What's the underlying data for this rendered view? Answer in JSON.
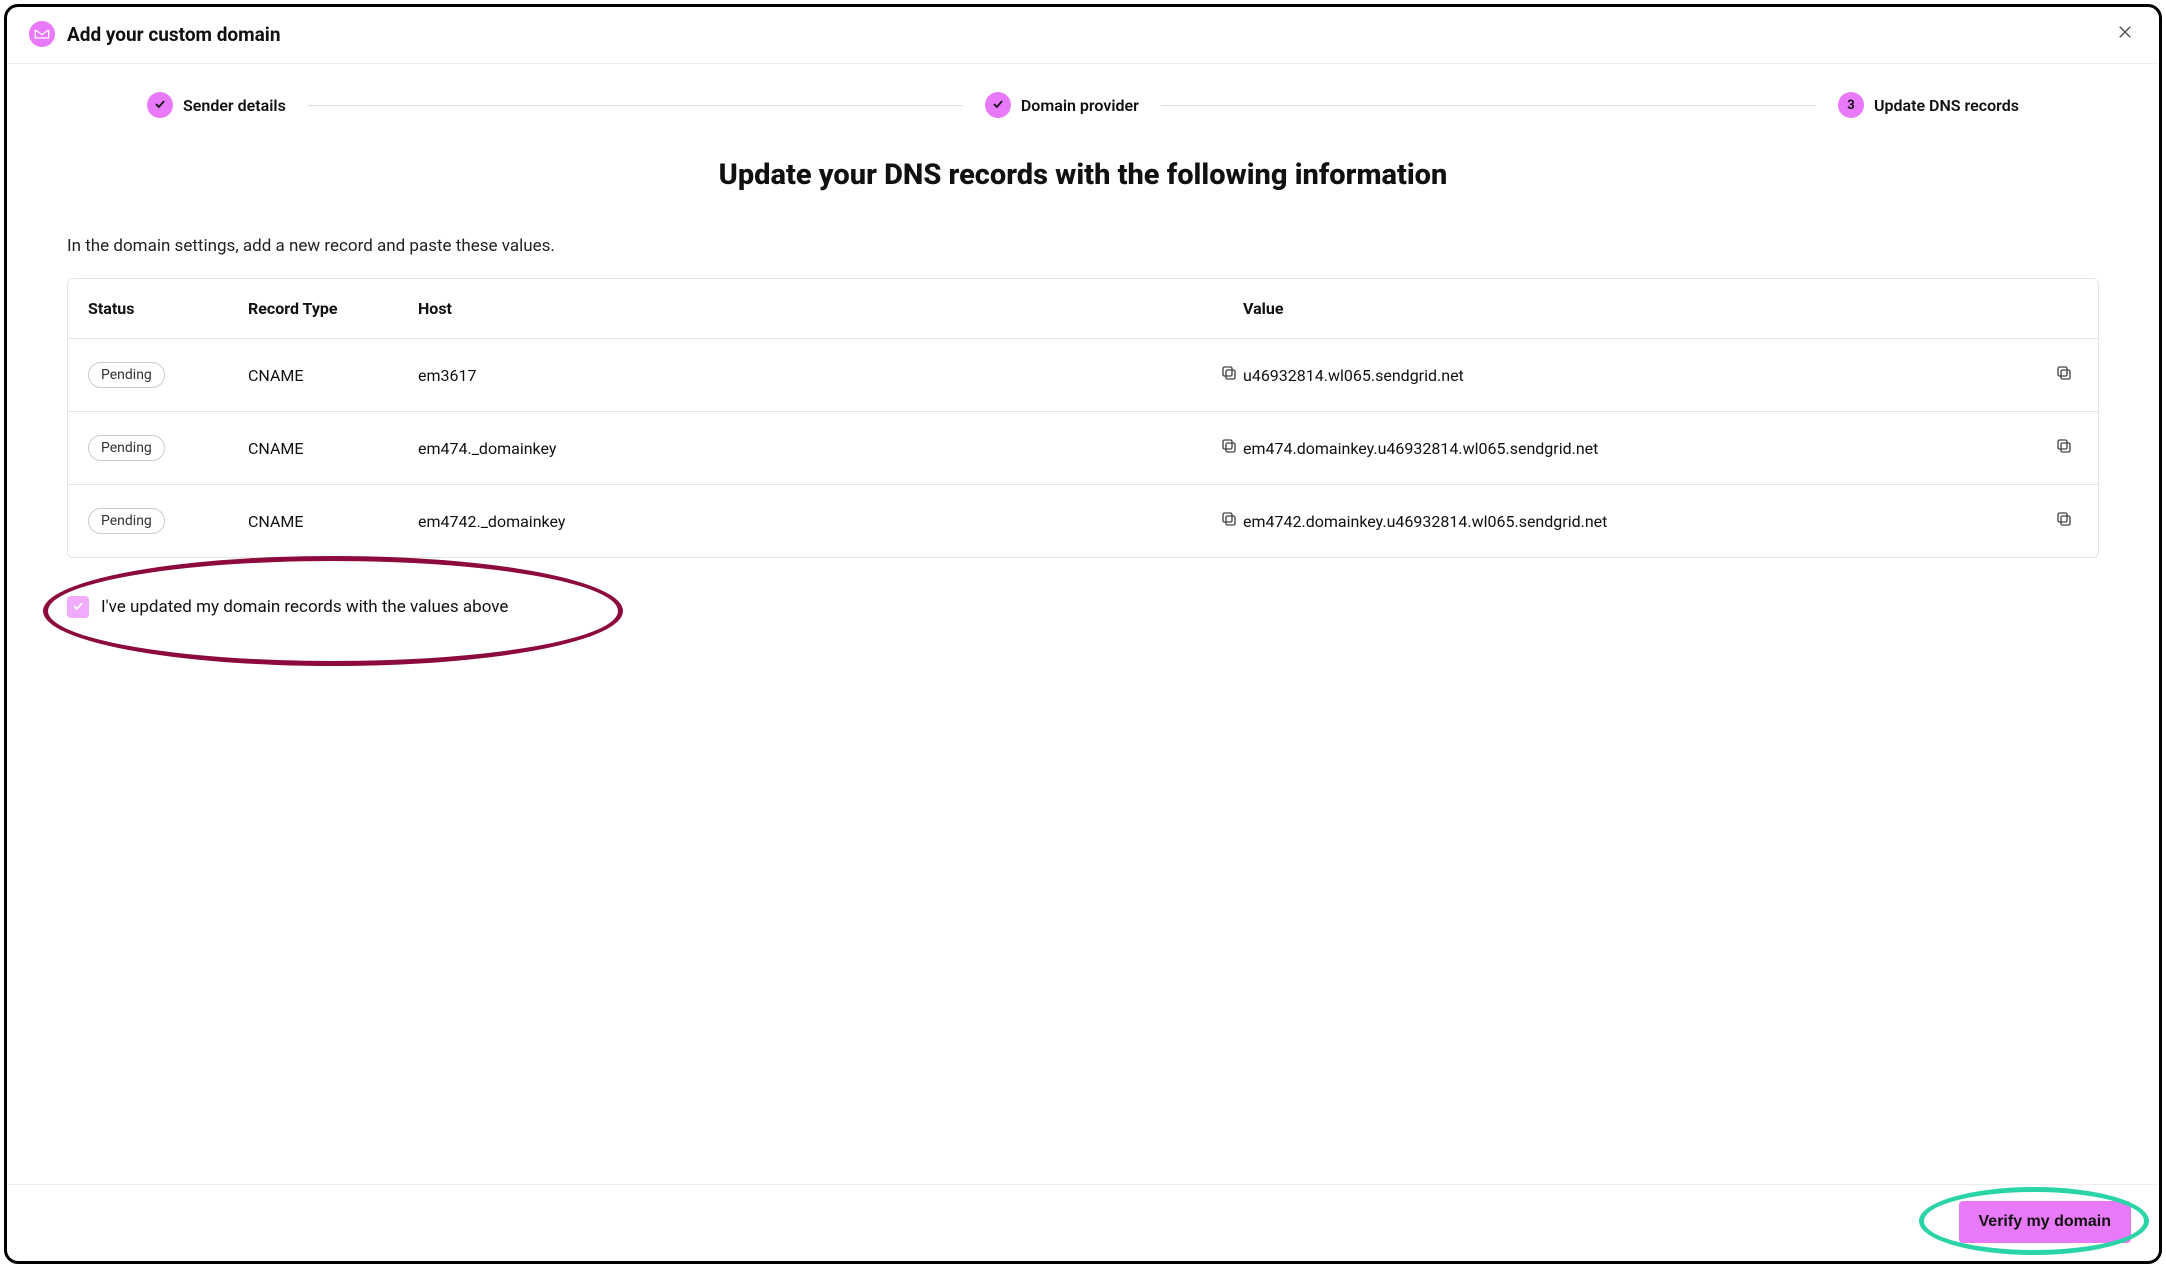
{
  "header": {
    "title": "Add your custom domain"
  },
  "stepper": {
    "step1": {
      "label": "Sender details"
    },
    "step2": {
      "label": "Domain provider"
    },
    "step3": {
      "number": "3",
      "label": "Update DNS records"
    }
  },
  "main": {
    "heading": "Update your DNS records with the following information",
    "instruction": "In the domain settings, add a new record and paste these values."
  },
  "table": {
    "headers": {
      "status": "Status",
      "record_type": "Record Type",
      "host": "Host",
      "value": "Value"
    },
    "rows": [
      {
        "status": "Pending",
        "record_type": "CNAME",
        "host": "em3617",
        "value": "u46932814.wl065.sendgrid.net"
      },
      {
        "status": "Pending",
        "record_type": "CNAME",
        "host": "em474._domainkey",
        "value": "em474.domainkey.u46932814.wl065.sendgrid.net"
      },
      {
        "status": "Pending",
        "record_type": "CNAME",
        "host": "em4742._domainkey",
        "value": "em4742.domainkey.u46932814.wl065.sendgrid.net"
      }
    ]
  },
  "confirm": {
    "label": "I've updated my domain records with the values above",
    "checked": true
  },
  "footer": {
    "verify_label": "Verify my domain"
  },
  "colors": {
    "accent": "#e879f9",
    "annotation_red": "#8c0a3c",
    "annotation_green": "#2bd4a7"
  }
}
